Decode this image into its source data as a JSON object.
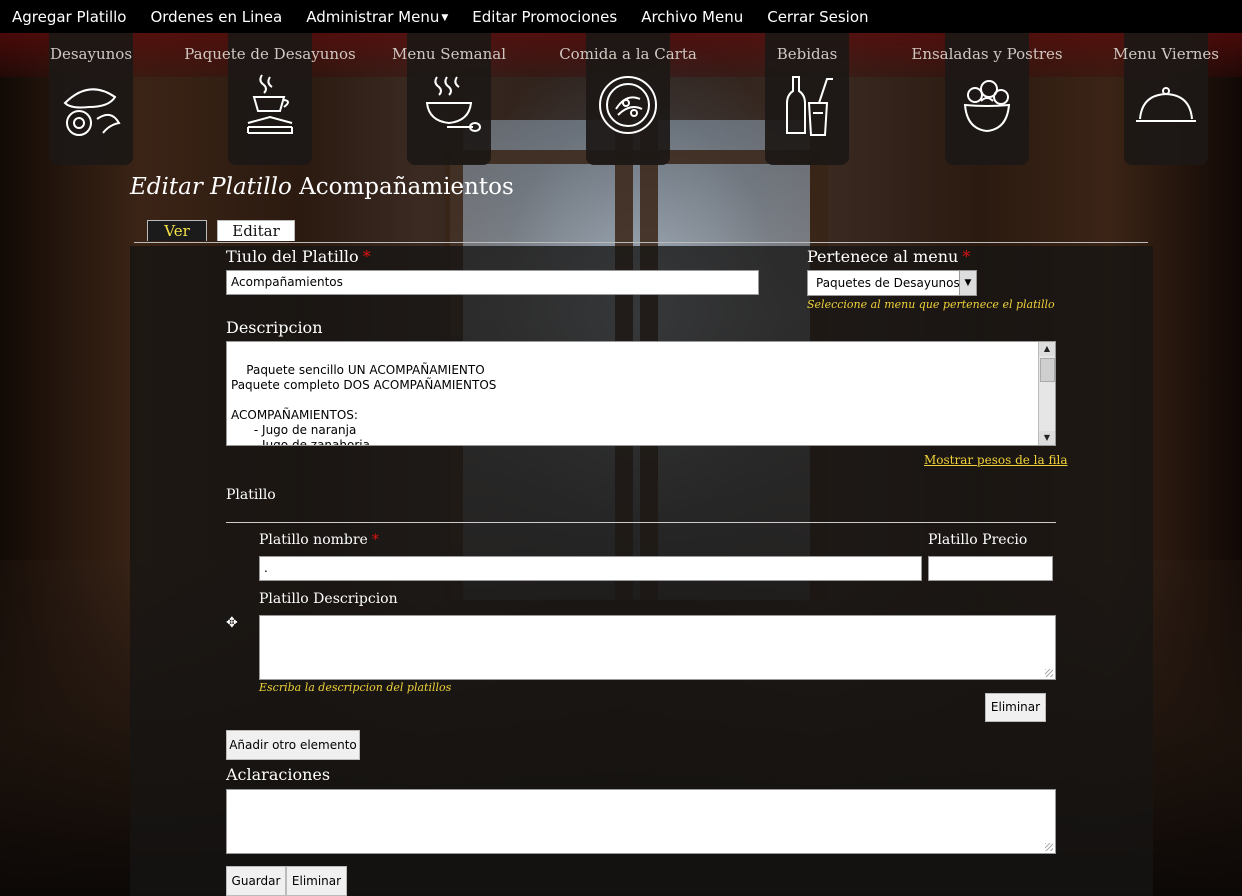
{
  "topnav": {
    "items": [
      "Agregar Platillo",
      "Ordenes en Linea",
      "Administrar Menu",
      "Editar Promociones",
      "Archivo Menu",
      "Cerrar Sesion"
    ]
  },
  "categories": [
    {
      "label": "Desayunos",
      "icon": "bread-icon"
    },
    {
      "label": "Paquete de Desayunos",
      "icon": "coffee-sandwich-icon"
    },
    {
      "label": "Menu Semanal",
      "icon": "soup-bowl-icon"
    },
    {
      "label": "Comida a la Carta",
      "icon": "plate-icon"
    },
    {
      "label": "Bebidas",
      "icon": "drinks-icon"
    },
    {
      "label": "Ensaladas y Postres",
      "icon": "salad-icon"
    },
    {
      "label": "Menu Viernes",
      "icon": "cloche-icon"
    }
  ],
  "page": {
    "title_prefix": "Editar Platillo",
    "title_name": "Acompañamientos"
  },
  "tabs": {
    "view": "Ver",
    "edit": "Editar"
  },
  "form": {
    "title_label": "Tiulo del Platillo",
    "title_value": "Acompañamientos",
    "menu_label": "Pertenece al menu",
    "menu_value": "Paquetes de Desayunos",
    "menu_hint": "Seleccione al menu que pertenece el platillo",
    "description_label": "Descripcion",
    "description_value": "Paquete sencillo UN ACOMPAÑAMIENTO\nPaquete completo DOS ACOMPAÑAMIENTOS\n\nACOMPAÑAMIENTOS:\n      - Jugo de naranja\n      - Jugo de zanahoria",
    "row_weights_link": "Mostrar pesos de la fila",
    "platillo_section": "Platillo",
    "platillo_name_label": "Platillo nombre",
    "platillo_name_value": ".",
    "platillo_price_label": "Platillo Precio",
    "platillo_price_value": "",
    "platillo_desc_label": "Platillo Descripcion",
    "platillo_desc_value": "",
    "platillo_desc_hint": "Escriba la descripcion del platillos",
    "remove_item_button": "Eliminar",
    "add_item_button": "Añadir otro elemento",
    "notes_label": "Aclaraciones",
    "notes_value": "",
    "save_button": "Guardar",
    "delete_button": "Eliminar"
  },
  "colors": {
    "hint": "#f0d23a",
    "required": "#dd1111",
    "ver_tab_text": "#f4e24a"
  }
}
